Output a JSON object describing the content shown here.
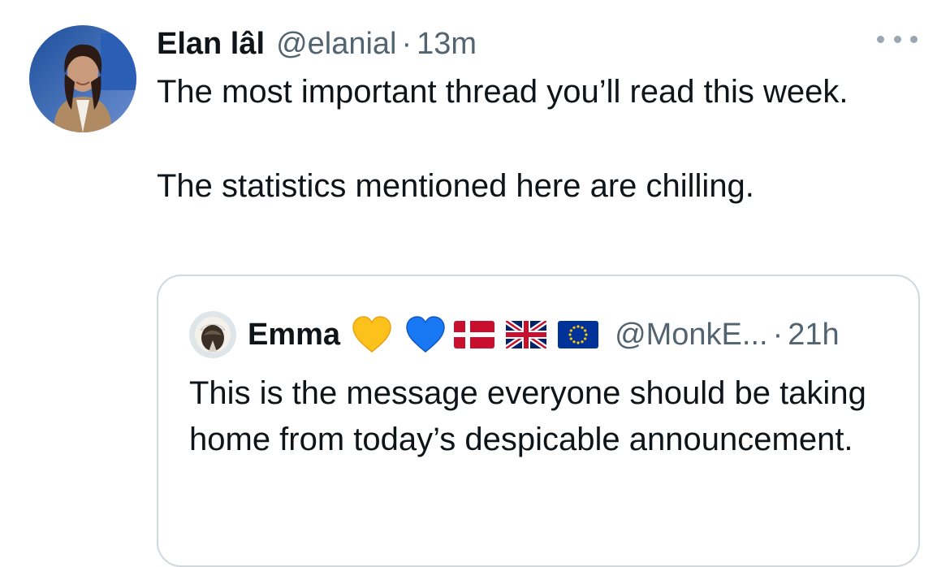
{
  "tweet": {
    "author_name": "Elan lâl",
    "author_handle": "@elanial",
    "separator": "·",
    "time": "13m",
    "more_icon": "more-horizontal-icon",
    "text_line1": "The most important thread you’ll read this week.",
    "text_line2": "The statistics mentioned here are chilling."
  },
  "quote": {
    "author_name": "Emma",
    "emojis": [
      "yellow-heart",
      "blue-heart",
      "flag-denmark",
      "flag-united-kingdom",
      "flag-european-union"
    ],
    "author_handle": "@MonkE...",
    "separator": "·",
    "time": "21h",
    "text": "This is the message everyone should be taking home from today’s despicable announcement."
  },
  "colors": {
    "text_primary": "#0f1419",
    "text_secondary": "#536471",
    "border": "#cfd9de",
    "yellow_heart": "#fcc21b",
    "blue_heart": "#1877f2"
  }
}
